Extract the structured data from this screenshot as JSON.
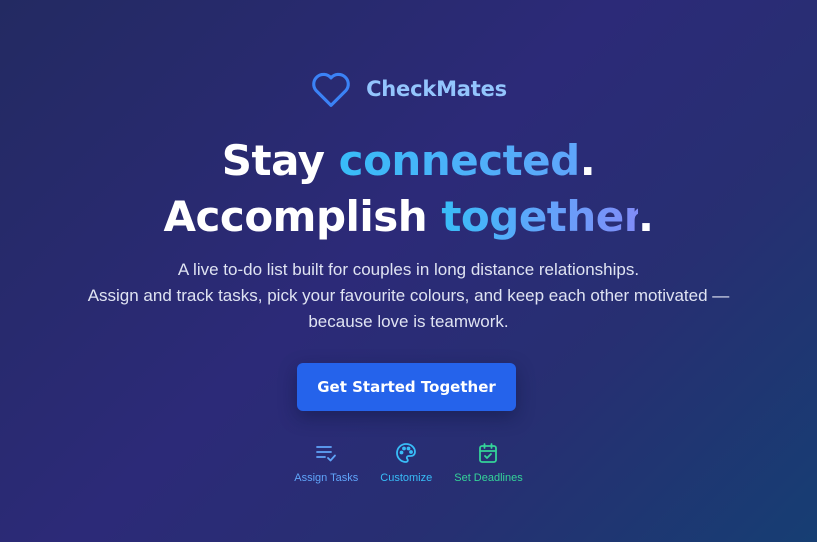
{
  "brand": {
    "name": "CheckMates",
    "icon": "heart-outline-icon",
    "color": "#93c5fd"
  },
  "headline": {
    "line1_start": "Stay ",
    "line1_highlight": "connected",
    "line1_end": ".",
    "line2_start": "Accomplish ",
    "line2_highlight": "together",
    "line2_end": "."
  },
  "subtitle": {
    "line1": "A live to-do list built for couples in long distance relationships.",
    "line2": "Assign and track tasks, pick your favourite colours, and keep each other motivated —",
    "line3": "because love is teamwork."
  },
  "cta": {
    "label": "Get Started Together",
    "color": "#2563eb"
  },
  "features": [
    {
      "label": "Assign Tasks",
      "icon": "list-check-icon",
      "color": "#60a5fa"
    },
    {
      "label": "Customize",
      "icon": "palette-icon",
      "color": "#38bdf8"
    },
    {
      "label": "Set Deadlines",
      "icon": "calendar-check-icon",
      "color": "#34d399"
    }
  ]
}
